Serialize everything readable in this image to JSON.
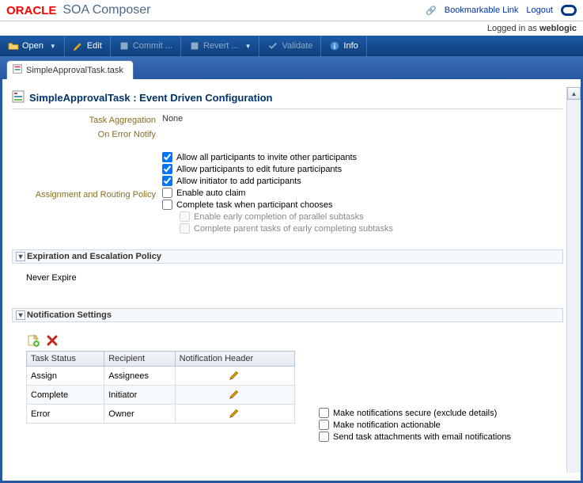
{
  "header": {
    "brand": "ORACLE",
    "product": "SOA Composer",
    "bookmark": "Bookmarkable Link",
    "logout": "Logout",
    "logged_in_prefix": "Logged in as ",
    "user": "weblogic"
  },
  "toolbar": {
    "open": "Open",
    "edit": "Edit",
    "commit": "Commit ...",
    "revert": "Revert ...",
    "validate": "Validate",
    "info": "Info"
  },
  "tab": {
    "file": "SimpleApprovalTask.task"
  },
  "page": {
    "title": "SimpleApprovalTask : Event Driven Configuration",
    "task_agg_label": "Task Aggregation",
    "task_agg_value": "None",
    "on_error_label": "On Error Notify",
    "routing_label": "Assignment and Routing Policy",
    "cb1": "Allow all participants to invite other participants",
    "cb2": "Allow participants to edit future participants",
    "cb3": "Allow initiator to add participants",
    "cb4": "Enable auto claim",
    "cb5": "Complete task when participant chooses",
    "cb6": "Enable early completion of parallel subtasks",
    "cb7": "Complete parent tasks of early completing subtasks"
  },
  "expiration": {
    "title": "Expiration and Escalation Policy",
    "value": "Never Expire"
  },
  "notification": {
    "title": "Notification Settings",
    "col1": "Task Status",
    "col2": "Recipient",
    "col3": "Notification Header",
    "rows": [
      {
        "status": "Assign",
        "recipient": "Assignees"
      },
      {
        "status": "Complete",
        "recipient": "Initiator"
      },
      {
        "status": "Error",
        "recipient": "Owner"
      }
    ],
    "opt1": "Make notifications secure (exclude details)",
    "opt2": "Make notification actionable",
    "opt3": "Send task attachments with email notifications"
  }
}
